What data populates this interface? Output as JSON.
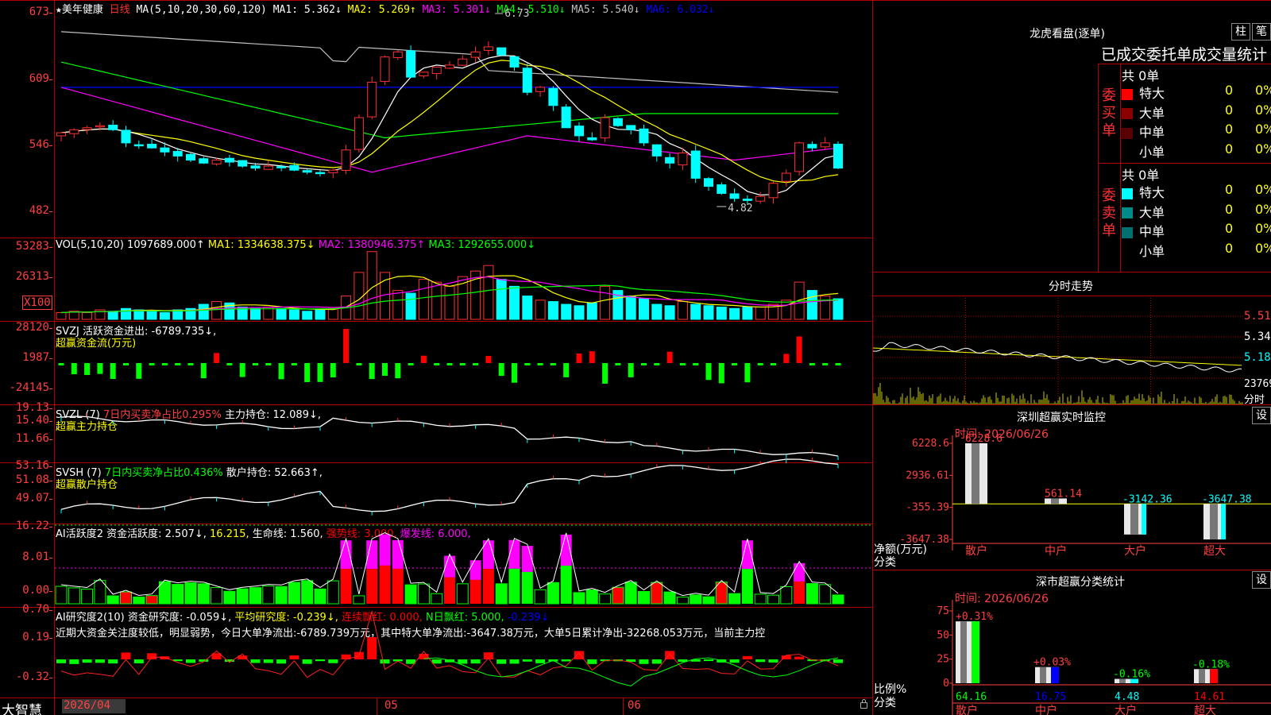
{
  "header": {
    "star": "★",
    "stock_name": "美年健康",
    "period": "日线",
    "ma_params": "MA(5,10,20,30,60,120)",
    "ma_items": [
      {
        "label": "MA1: 5.362↓",
        "color": "#ffffff"
      },
      {
        "label": "MA2: 5.269↑",
        "color": "#ffff00"
      },
      {
        "label": "MA3: 5.301↓",
        "color": "#ff00ff"
      },
      {
        "label": "MA4: 5.510↓",
        "color": "#00ff00"
      },
      {
        "label": "MA5: 5.540↓",
        "color": "#c0c0c0"
      },
      {
        "label": "MA6: 6.032↓",
        "color": "#0000ff"
      }
    ],
    "high_mark": "6.73",
    "low_mark": "4.82"
  },
  "price_axis": [
    "673",
    "609",
    "546",
    "482"
  ],
  "vol": {
    "header": [
      {
        "t": "VOL(5,10,20)",
        "c": "#ffffff"
      },
      {
        "t": "1097689.000↑",
        "c": "#ffffff"
      },
      {
        "t": "MA1: 1334638.375↓",
        "c": "#ffff00"
      },
      {
        "t": "MA2: 1380946.375↑",
        "c": "#ff00ff"
      },
      {
        "t": "MA3: 1292655.000↓",
        "c": "#00ff00"
      }
    ],
    "axis": [
      "53283",
      "26313"
    ],
    "unit": "X100"
  },
  "svzj": {
    "header": [
      {
        "t": "SVZJ  活跃资金进出: -6789.735↓,",
        "c": "#ffffff"
      }
    ],
    "title": "超赢资金流(万元)",
    "axis": [
      "28120",
      "1987",
      "-24145"
    ]
  },
  "svzl": {
    "header": [
      {
        "t": "SVZL (7)",
        "c": "#ffffff"
      },
      {
        "t": "7日内买卖净占比0.295%",
        "c": "#ff4040"
      },
      {
        "t": "主力持仓: 12.089↓,",
        "c": "#ffffff"
      }
    ],
    "title": "超赢主力持仓",
    "axis": [
      "19.13",
      "15.40",
      "11.66"
    ]
  },
  "svsh": {
    "header": [
      {
        "t": "SVSH (7)",
        "c": "#ffffff"
      },
      {
        "t": "7日内买卖净占比0.436%",
        "c": "#00ff00"
      },
      {
        "t": "散户持仓: 52.663↑,",
        "c": "#ffffff"
      }
    ],
    "title": "超赢散户持仓",
    "axis": [
      "53.16",
      "51.08",
      "49.07"
    ]
  },
  "ai1": {
    "header": [
      {
        "t": "AI活跃度2",
        "c": "#ffffff"
      },
      {
        "t": "资金活跃度: 2.507↓,",
        "c": "#ffffff"
      },
      {
        "t": "16.215,",
        "c": "#ffff00"
      },
      {
        "t": "生命线: 1.560,",
        "c": "#ffffff"
      },
      {
        "t": "强势线: 3.000,",
        "c": "#ff0000"
      },
      {
        "t": "爆发线: 6.000,",
        "c": "#ff00ff"
      }
    ],
    "axis": [
      "16.22",
      "8.01",
      "0.00"
    ]
  },
  "ai2": {
    "header": [
      {
        "t": "AI研究度2(10)",
        "c": "#ffffff"
      },
      {
        "t": "资金研究度: -0.059↓,",
        "c": "#ffffff"
      },
      {
        "t": "平均研究度: -0.239↓,",
        "c": "#ffff00"
      },
      {
        "t": "连续飘红: 0.000,",
        "c": "#ff0000"
      },
      {
        "t": "N日飘红: 5.000,",
        "c": "#00ff00"
      },
      {
        "t": "-0.239↓",
        "c": "#0000ff"
      }
    ],
    "comment": "近期大资金关注度较低，明显弱势，今日大单净流出:-6789.739万元，其中特大单净流出:-3647.38万元，大单5日累计净出-32268.053万元，当前主力控",
    "axis": [
      "0.70",
      "0.19",
      "-0.32"
    ]
  },
  "footer": {
    "brand": "大智慧",
    "dates": [
      "2026/04",
      "05",
      "06"
    ],
    "lock_icon": "lock-icon"
  },
  "right": {
    "title": "龙虎看盘(逐单)",
    "btn_bar": "柱",
    "btn_pen": "笔",
    "ob_title": "已成交委托单成交量统计",
    "buy_label": "委买单",
    "sell_label": "委卖单",
    "buy_total": "共 0单",
    "sell_total": "共 0单",
    "buy_rows": [
      {
        "name": "特大",
        "v": "0",
        "p": "0%",
        "color": "#ff0000"
      },
      {
        "name": "大单",
        "v": "0",
        "p": "0%",
        "color": "#8b0000"
      },
      {
        "name": "中单",
        "v": "0",
        "p": "0%",
        "color": "#5a0000"
      },
      {
        "name": "小单",
        "v": "0",
        "p": "0%",
        "color": ""
      }
    ],
    "sell_rows": [
      {
        "name": "特大",
        "v": "0",
        "p": "0%",
        "color": "#00ffff"
      },
      {
        "name": "大单",
        "v": "0",
        "p": "0%",
        "color": "#008b8b"
      },
      {
        "name": "中单",
        "v": "0",
        "p": "0%",
        "color": "#007070"
      },
      {
        "name": "小单",
        "v": "0",
        "p": "0%",
        "color": ""
      }
    ],
    "intraday_title": "分时走势",
    "intraday_axis": [
      "5.51",
      "5.34",
      "5.18"
    ],
    "intraday_vol": "23769",
    "intraday_unit": "分时",
    "sz_title": "深圳超赢实时监控",
    "sz_btn": "设",
    "sz_time": "时间: 2026/06/26",
    "sz_axis": [
      "6228.6",
      "2936.61",
      "-355.39",
      "-3647.38"
    ],
    "sz_ylabel": "净额(万元)",
    "sz_xlabel": "分类",
    "sz_bars": [
      {
        "name": "散户",
        "value": 6228.6,
        "label": "6228.6"
      },
      {
        "name": "中户",
        "value": 561.14,
        "label": "561.14"
      },
      {
        "name": "大户",
        "value": -3142.36,
        "label": "-3142.36"
      },
      {
        "name": "超大",
        "value": -3647.38,
        "label": "-3647.38"
      }
    ],
    "cls_title": "深市超赢分类统计",
    "cls_btn": "设",
    "cls_time": "时间: 2026/06/26",
    "cls_axis": [
      "75",
      "50",
      "25",
      "0"
    ],
    "cls_ylabel": "比例%",
    "cls_xlabel": "分类",
    "cls_bars": [
      {
        "name": "散户",
        "value": 64.16,
        "label": "64.16",
        "delta": "+0.31%",
        "color": "#00ff00"
      },
      {
        "name": "中户",
        "value": 16.75,
        "label": "16.75",
        "delta": "+0.03%",
        "color": "#0000ff"
      },
      {
        "name": "大户",
        "value": 4.48,
        "label": "4.48",
        "delta": "-0.16%",
        "color": "#00ffff"
      },
      {
        "name": "超大",
        "value": 14.61,
        "label": "14.61",
        "delta": "-0.18%",
        "color": "#ff0000"
      }
    ]
  }
}
